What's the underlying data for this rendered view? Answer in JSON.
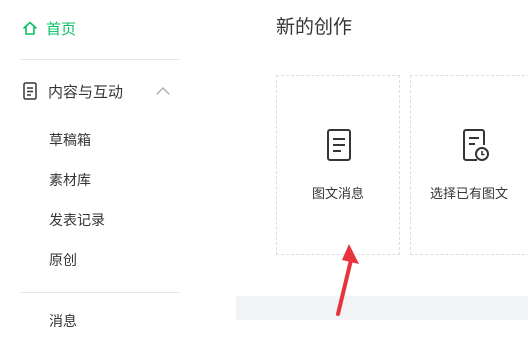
{
  "sidebar": {
    "home": {
      "label": "首页",
      "icon": "home-icon"
    },
    "section": {
      "label": "内容与互动",
      "icon": "document-icon",
      "toggle_icon": "chevron-up-icon"
    },
    "items": [
      {
        "label": "草稿箱"
      },
      {
        "label": "素材库"
      },
      {
        "label": "发表记录"
      },
      {
        "label": "原创"
      }
    ],
    "messages": {
      "label": "消息"
    }
  },
  "main": {
    "title": "新的创作",
    "tiles": [
      {
        "label": "图文消息",
        "icon": "article-icon"
      },
      {
        "label": "选择已有图文",
        "icon": "article-history-icon"
      }
    ]
  },
  "colors": {
    "accent": "#07c160",
    "arrow": "#e8323c"
  }
}
